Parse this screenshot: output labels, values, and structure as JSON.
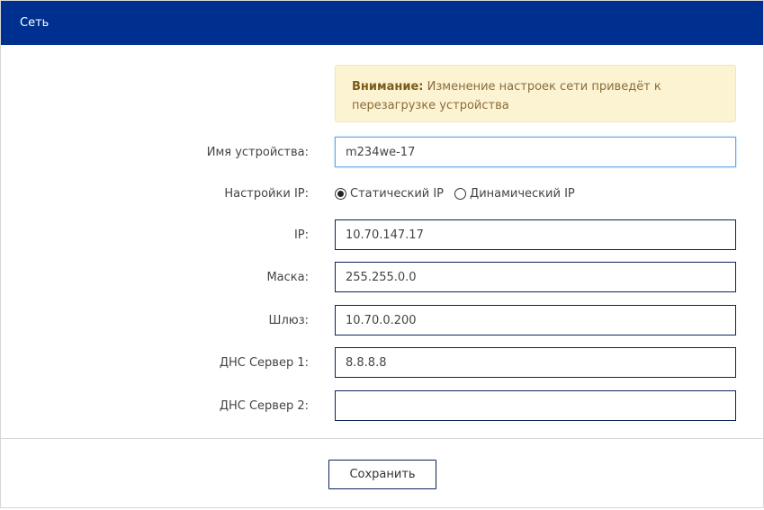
{
  "header": {
    "title": "Сеть"
  },
  "alert": {
    "strong": "Внимание:",
    "text": " Изменение настроек сети приведёт к перезагрузке устройства"
  },
  "form": {
    "device_name": {
      "label": "Имя устройства:",
      "value": "m234we-17"
    },
    "ip_settings": {
      "label": "Настройки IP:",
      "options": [
        {
          "label": "Статический IP",
          "selected": true
        },
        {
          "label": "Динамический IP",
          "selected": false
        }
      ]
    },
    "ip": {
      "label": "IP:",
      "value": "10.70.147.17"
    },
    "mask": {
      "label": "Маска:",
      "value": "255.255.0.0"
    },
    "gateway": {
      "label": "Шлюз:",
      "value": "10.70.0.200"
    },
    "dns1": {
      "label": "ДНС Сервер 1:",
      "value": "8.8.8.8"
    },
    "dns2": {
      "label": "ДНС Сервер 2:",
      "value": ""
    }
  },
  "footer": {
    "save_label": "Сохранить"
  },
  "colors": {
    "header_bg": "#00308f",
    "alert_bg": "#fcf3d2",
    "alert_text": "#8a6d3b",
    "input_border": "#0b2455",
    "focus_border": "#6aa5dd"
  }
}
